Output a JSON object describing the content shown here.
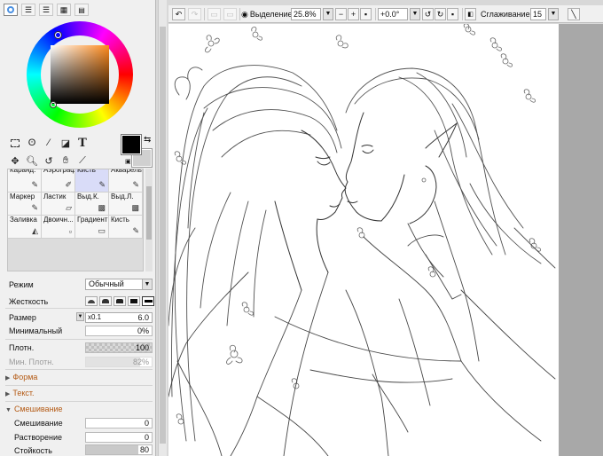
{
  "colors": {
    "foreground": "#000000",
    "background": "#d0d0d0",
    "selected_brush": "#d9dcf8",
    "section_header": "#b45a14"
  },
  "panel_tabs": [
    {
      "icon": "color-wheel-icon"
    },
    {
      "icon": "rgb-sliders-icon"
    },
    {
      "icon": "hsv-sliders-icon"
    },
    {
      "icon": "swatches-icon"
    },
    {
      "icon": "user-colors-icon"
    }
  ],
  "color_wheel": {
    "hue": "orange",
    "saturation_value_marker": "bottom-left"
  },
  "tools": [
    {
      "icon": "rect-select-icon"
    },
    {
      "icon": "lasso-icon"
    },
    {
      "icon": "magic-wand-icon"
    },
    {
      "icon": "bucket-select-icon"
    },
    {
      "icon": "text-tool-icon",
      "glyph": "T"
    },
    {
      "icon": "move-icon"
    },
    {
      "icon": "zoom-icon"
    },
    {
      "icon": "rotate-icon"
    },
    {
      "icon": "hand-icon"
    },
    {
      "icon": "eyedropper-icon"
    }
  ],
  "brushes": [
    {
      "label": "Каранд.",
      "icon": "pencil-icon",
      "glyph": "✎"
    },
    {
      "label": "Аэрограф",
      "icon": "airbrush-icon",
      "glyph": "✐"
    },
    {
      "label": "Кисть",
      "icon": "brush-icon",
      "glyph": "✎"
    },
    {
      "label": "Акварель",
      "icon": "watercolor-icon",
      "glyph": "✎"
    },
    {
      "label": "Маркер",
      "icon": "marker-icon",
      "glyph": "✎"
    },
    {
      "label": "Ластик",
      "icon": "eraser-icon",
      "glyph": "▱"
    },
    {
      "label": "Выд.К.",
      "icon": "select-pen-icon",
      "glyph": "▩"
    },
    {
      "label": "Выд.Л.",
      "icon": "select-eraser-icon",
      "glyph": "▩"
    },
    {
      "label": "Заливка",
      "icon": "bucket-icon",
      "glyph": "◭"
    },
    {
      "label": "Двоичн...",
      "icon": "binary-pen-icon",
      "glyph": "▫"
    },
    {
      "label": "Градиент",
      "icon": "gradient-icon",
      "glyph": "▭"
    },
    {
      "label": "Кисть",
      "icon": "brush-2-icon",
      "glyph": "✎"
    }
  ],
  "selected_brush_index": 2,
  "properties": {
    "mode_label": "Режим",
    "mode_value": "Обычный",
    "hardness_label": "Жесткость",
    "size_label": "Размер",
    "size_multiplier": "x0.1",
    "size_value": "6.0",
    "min_size_label": "Минимальный",
    "min_size_value": "0%",
    "min_size_fraction": 0,
    "density_label": "Плотн.",
    "density_value": "100",
    "density_fraction": 1.0,
    "min_density_label": "Мин. Плотн.",
    "min_density_value": "82%",
    "min_density_fraction": 0.82
  },
  "sections": {
    "shape": "Форма",
    "texture": "Текст.",
    "blending": "Смешивание"
  },
  "blending": {
    "blend_label": "Смешивание",
    "blend_value": "0",
    "blend_fraction": 0,
    "dilution_label": "Растворение",
    "dilution_value": "0",
    "dilution_fraction": 0,
    "persistence_label": "Стойкость",
    "persistence_value": "80",
    "persistence_fraction": 0.8
  },
  "toolbar": {
    "selection_label": "Выделение",
    "zoom": "25.8%",
    "rotation": "+0.0°",
    "stabilizer_label": "Сглаживание",
    "stabilizer_value": "15"
  }
}
